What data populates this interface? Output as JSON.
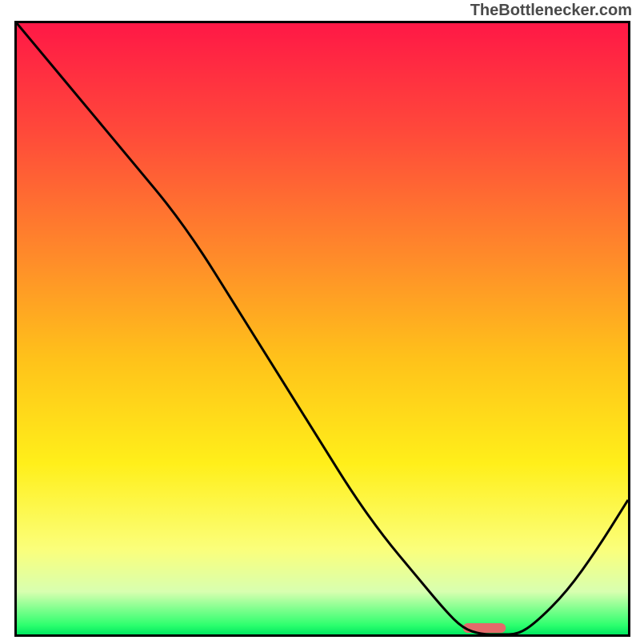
{
  "watermark": "TheBottlenecker.com",
  "chart_data": {
    "type": "line",
    "title": "",
    "xlabel": "",
    "ylabel": "",
    "xlim": [
      0,
      100
    ],
    "ylim": [
      0,
      100
    ],
    "x": [
      0,
      5,
      10,
      15,
      20,
      25,
      30,
      35,
      40,
      45,
      50,
      55,
      60,
      65,
      70,
      73,
      76,
      79,
      82,
      85,
      90,
      95,
      100
    ],
    "values": [
      100,
      94,
      88,
      82,
      76,
      70,
      63,
      55,
      47,
      39,
      31,
      23,
      16,
      10,
      4,
      1,
      0,
      0,
      0,
      2,
      7,
      14,
      22
    ],
    "marker": {
      "x_start": 73,
      "x_end": 80,
      "color": "#e46a6a"
    },
    "gradient_stops": [
      {
        "offset": 0.0,
        "color": "#ff1846"
      },
      {
        "offset": 0.18,
        "color": "#ff4a3a"
      },
      {
        "offset": 0.38,
        "color": "#ff8a2a"
      },
      {
        "offset": 0.55,
        "color": "#ffc21a"
      },
      {
        "offset": 0.72,
        "color": "#ffef1a"
      },
      {
        "offset": 0.86,
        "color": "#fbff7a"
      },
      {
        "offset": 0.93,
        "color": "#d8ffb0"
      },
      {
        "offset": 0.985,
        "color": "#2dff6e"
      },
      {
        "offset": 1.0,
        "color": "#00e860"
      }
    ]
  }
}
